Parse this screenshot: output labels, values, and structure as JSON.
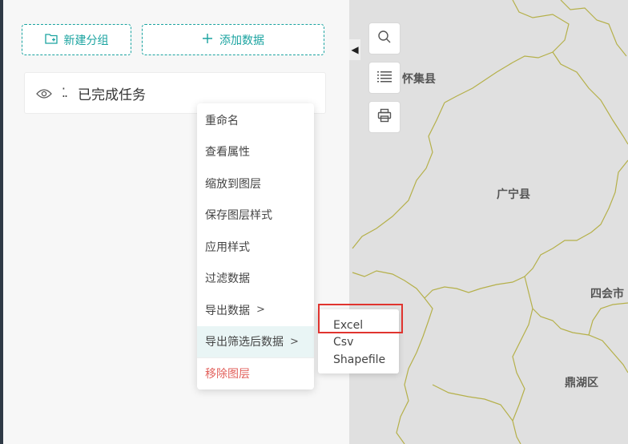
{
  "panel": {
    "new_group_label": "新建分组",
    "add_data_label": "添加数据",
    "layer": {
      "name": "已完成任务",
      "drag_glyph": "⁚."
    }
  },
  "map": {
    "labels": [
      "怀集县",
      "广宁县",
      "四会市",
      "鼎湖区"
    ],
    "colors": {
      "background": "#e0e0e0",
      "boundary": "#b5b04a"
    }
  },
  "tools": {
    "icons": [
      "search-icon",
      "list-icon",
      "print-icon"
    ]
  },
  "context_menu": {
    "items": [
      {
        "label": "重命名"
      },
      {
        "label": "查看属性"
      },
      {
        "label": "缩放到图层"
      },
      {
        "label": "保存图层样式"
      },
      {
        "label": "应用样式"
      },
      {
        "label": "过滤数据"
      },
      {
        "label": "导出数据",
        "arrow": ">"
      },
      {
        "label": "导出筛选后数据",
        "arrow": ">"
      },
      {
        "label": "移除图层"
      }
    ]
  },
  "submenu": {
    "items": [
      "Excel",
      "Csv",
      "Shapefile"
    ]
  },
  "colors": {
    "accent": "#1aa3a0",
    "danger": "#e2615c",
    "highlight": "#e0342f"
  }
}
